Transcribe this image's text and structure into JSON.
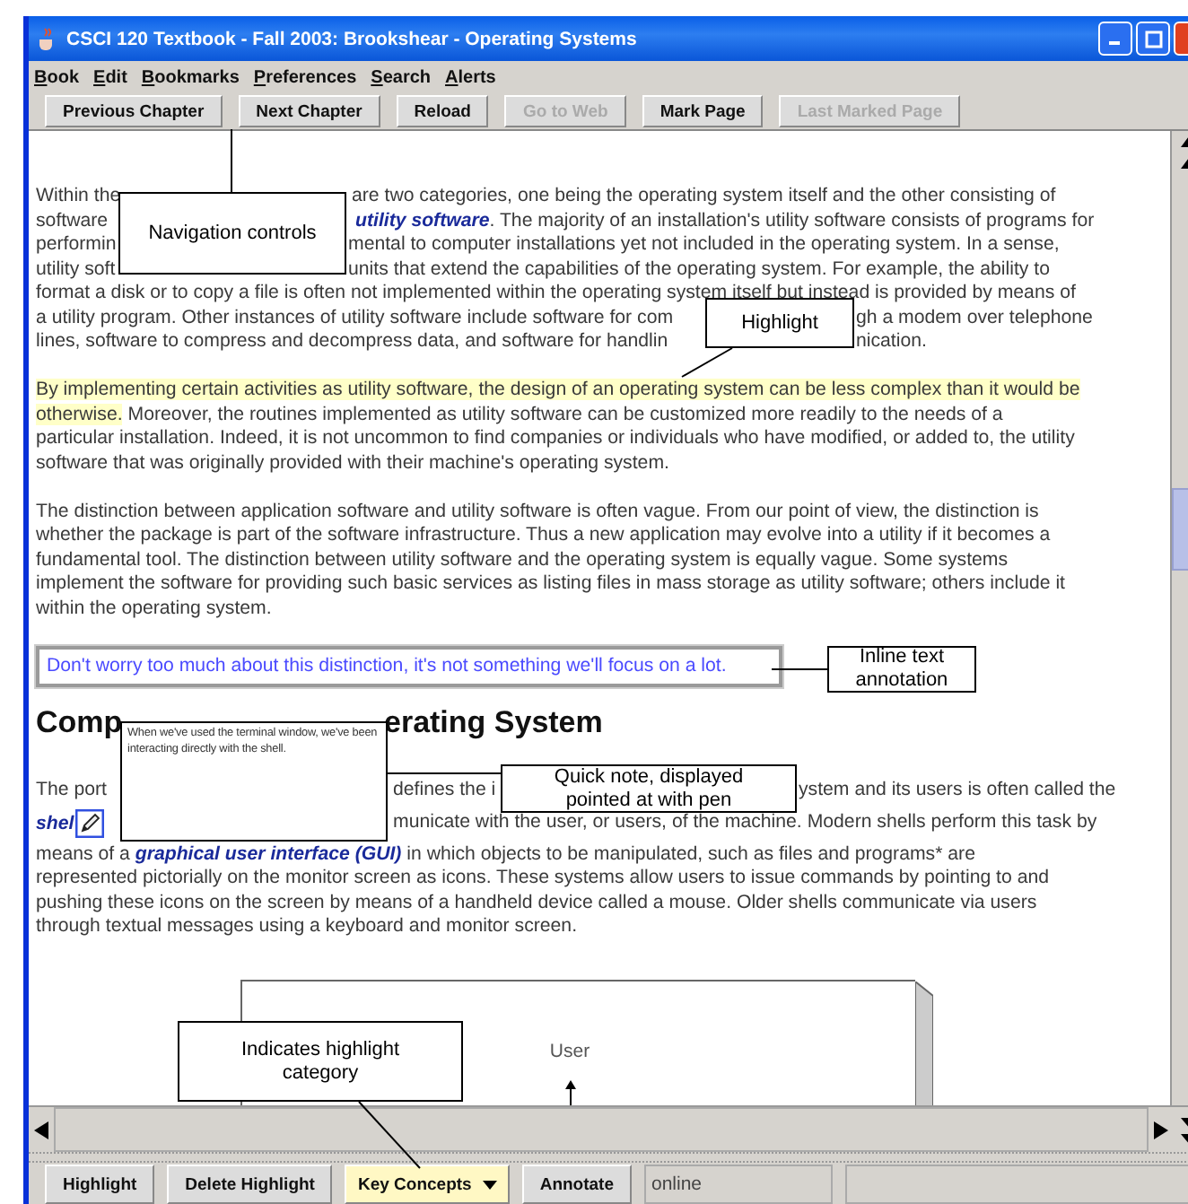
{
  "window": {
    "title": "CSCI 120 Textbook - Fall 2003: Brookshear - Operating Systems"
  },
  "menu": [
    "Book",
    "Edit",
    "Bookmarks",
    "Preferences",
    "Search",
    "Alerts"
  ],
  "toolbar": [
    {
      "label": "Previous Chapter",
      "disabled": false
    },
    {
      "label": "Next Chapter",
      "disabled": false
    },
    {
      "label": "Reload",
      "disabled": false
    },
    {
      "label": "Go to Web",
      "disabled": true
    },
    {
      "label": "Mark Page",
      "disabled": false
    },
    {
      "label": "Last Marked Page",
      "disabled": true
    }
  ],
  "document": [
    {
      "kind": "paragraph",
      "lines": [
        [
          {
            "kind": "text",
            "text": "Within the"
          },
          {
            "kind": "gap"
          },
          {
            "kind": "text",
            "text": "are two categories, one being the operating system itself and the other consisting of"
          }
        ],
        [
          {
            "kind": "text",
            "text": "software"
          },
          {
            "kind": "gap"
          },
          {
            "kind": "term",
            "text": "utility software"
          },
          {
            "kind": "text",
            "text": ". The majority of an installation's utility software consists of programs for"
          }
        ],
        [
          {
            "kind": "text",
            "text": "performin"
          },
          {
            "kind": "gap"
          },
          {
            "kind": "text",
            "text": "mental to computer installations yet not included in the operating system. In a sense,"
          }
        ],
        [
          {
            "kind": "text",
            "text": "utility soft"
          },
          {
            "kind": "gap"
          },
          {
            "kind": "text",
            "text": "units that extend the capabilities of the operating system. For example, the ability to"
          }
        ],
        [
          {
            "kind": "text",
            "text": "format a disk or to copy a file is often not implemented within the operating system itself but instead is provided by means of"
          }
        ],
        [
          {
            "kind": "text",
            "text": "a utility program. Other instances of utility software include software for com"
          },
          {
            "kind": "gap"
          },
          {
            "kind": "text",
            "text": "gh a modem over telephone"
          }
        ],
        [
          {
            "kind": "text",
            "text": "lines, software to compress and decompress data, and software for handlin"
          },
          {
            "kind": "gap"
          },
          {
            "kind": "text",
            "text": "nication."
          }
        ]
      ]
    },
    {
      "kind": "paragraph",
      "lines": [
        [
          {
            "kind": "mark",
            "text": "By implementing certain activities as utility software, the design of an operating system can be less complex than it would be"
          }
        ],
        [
          {
            "kind": "mark",
            "text": "otherwise."
          },
          {
            "kind": "text",
            "text": " Moreover, the routines implemented as utility software can be customized more readily to the needs of a"
          }
        ],
        [
          {
            "kind": "text",
            "text": "particular installation. Indeed, it is not uncommon to find companies or individuals who have modified, or added to, the utility"
          }
        ],
        [
          {
            "kind": "text",
            "text": "software that was originally provided with their machine's operating system."
          }
        ]
      ]
    },
    {
      "kind": "paragraph",
      "lines": [
        [
          {
            "kind": "text",
            "text": "The distinction between application software and utility software is often vague. From our point of view, the distinction is"
          }
        ],
        [
          {
            "kind": "text",
            "text": "whether the package is part of the software infrastructure. Thus a new application may evolve into a utility if it becomes a"
          }
        ],
        [
          {
            "kind": "text",
            "text": "fundamental tool. The distinction between utility software and the operating system is equally vague. Some systems"
          }
        ],
        [
          {
            "kind": "text",
            "text": "implement the software for providing such basic services as listing files in mass storage as utility software; others include it"
          }
        ],
        [
          {
            "kind": "text",
            "text": "within the operating system."
          }
        ]
      ]
    },
    {
      "kind": "annotation",
      "text": "Don't worry too much about this distinction, it's not something we'll focus on a lot."
    },
    {
      "kind": "heading",
      "lines": [
        [
          {
            "kind": "text",
            "text": "Comp"
          },
          {
            "kind": "gap"
          },
          {
            "kind": "text",
            "text": "erating System"
          }
        ]
      ]
    },
    {
      "kind": "paragraph",
      "lines": [
        [
          {
            "kind": "text",
            "text": "The port"
          },
          {
            "kind": "gap"
          },
          {
            "kind": "text",
            "text": "defines the i"
          },
          {
            "kind": "gap"
          },
          {
            "kind": "text",
            "text": "ystem and its users is often called the"
          }
        ],
        [
          {
            "kind": "term",
            "text": "shel"
          },
          {
            "kind": "note"
          },
          {
            "kind": "gap"
          },
          {
            "kind": "text",
            "text": "municate with the user, or users, of the machine. Modern shells perform this task by"
          }
        ],
        [
          {
            "kind": "text",
            "text": "means of a "
          },
          {
            "kind": "term",
            "text": "graphical user interface (GUI)"
          },
          {
            "kind": "text",
            "text": " in which objects to be manipulated, such as files and programs* are"
          }
        ],
        [
          {
            "kind": "text",
            "text": "represented pictorially on the monitor screen as icons. These systems allow users to issue commands by pointing to and"
          }
        ],
        [
          {
            "kind": "text",
            "text": "pushing these icons on the screen by means of a handheld device called a mouse. Older shells communicate via users"
          }
        ],
        [
          {
            "kind": "text",
            "text": "through textual messages using a keyboard and monitor screen."
          }
        ]
      ]
    },
    {
      "kind": "figure",
      "label": "User"
    }
  ],
  "quick_note": {
    "text": "When we've used the terminal window, we've been interacting directly with the shell."
  },
  "callouts": [
    {
      "text": "Navigation controls"
    },
    {
      "text": "Highlight"
    },
    {
      "text": "Inline text annotation"
    },
    {
      "text": "Quick note, displayed pointed at with pen"
    },
    {
      "text": "Indicates highlight category"
    }
  ],
  "bottom_bar": {
    "buttons": [
      {
        "label": "Highlight",
        "kind": "button"
      },
      {
        "label": "Delete Highlight",
        "kind": "button"
      },
      {
        "label": "Key Concepts",
        "kind": "dropdown"
      },
      {
        "label": "Annotate",
        "kind": "button"
      }
    ],
    "status": "online"
  }
}
